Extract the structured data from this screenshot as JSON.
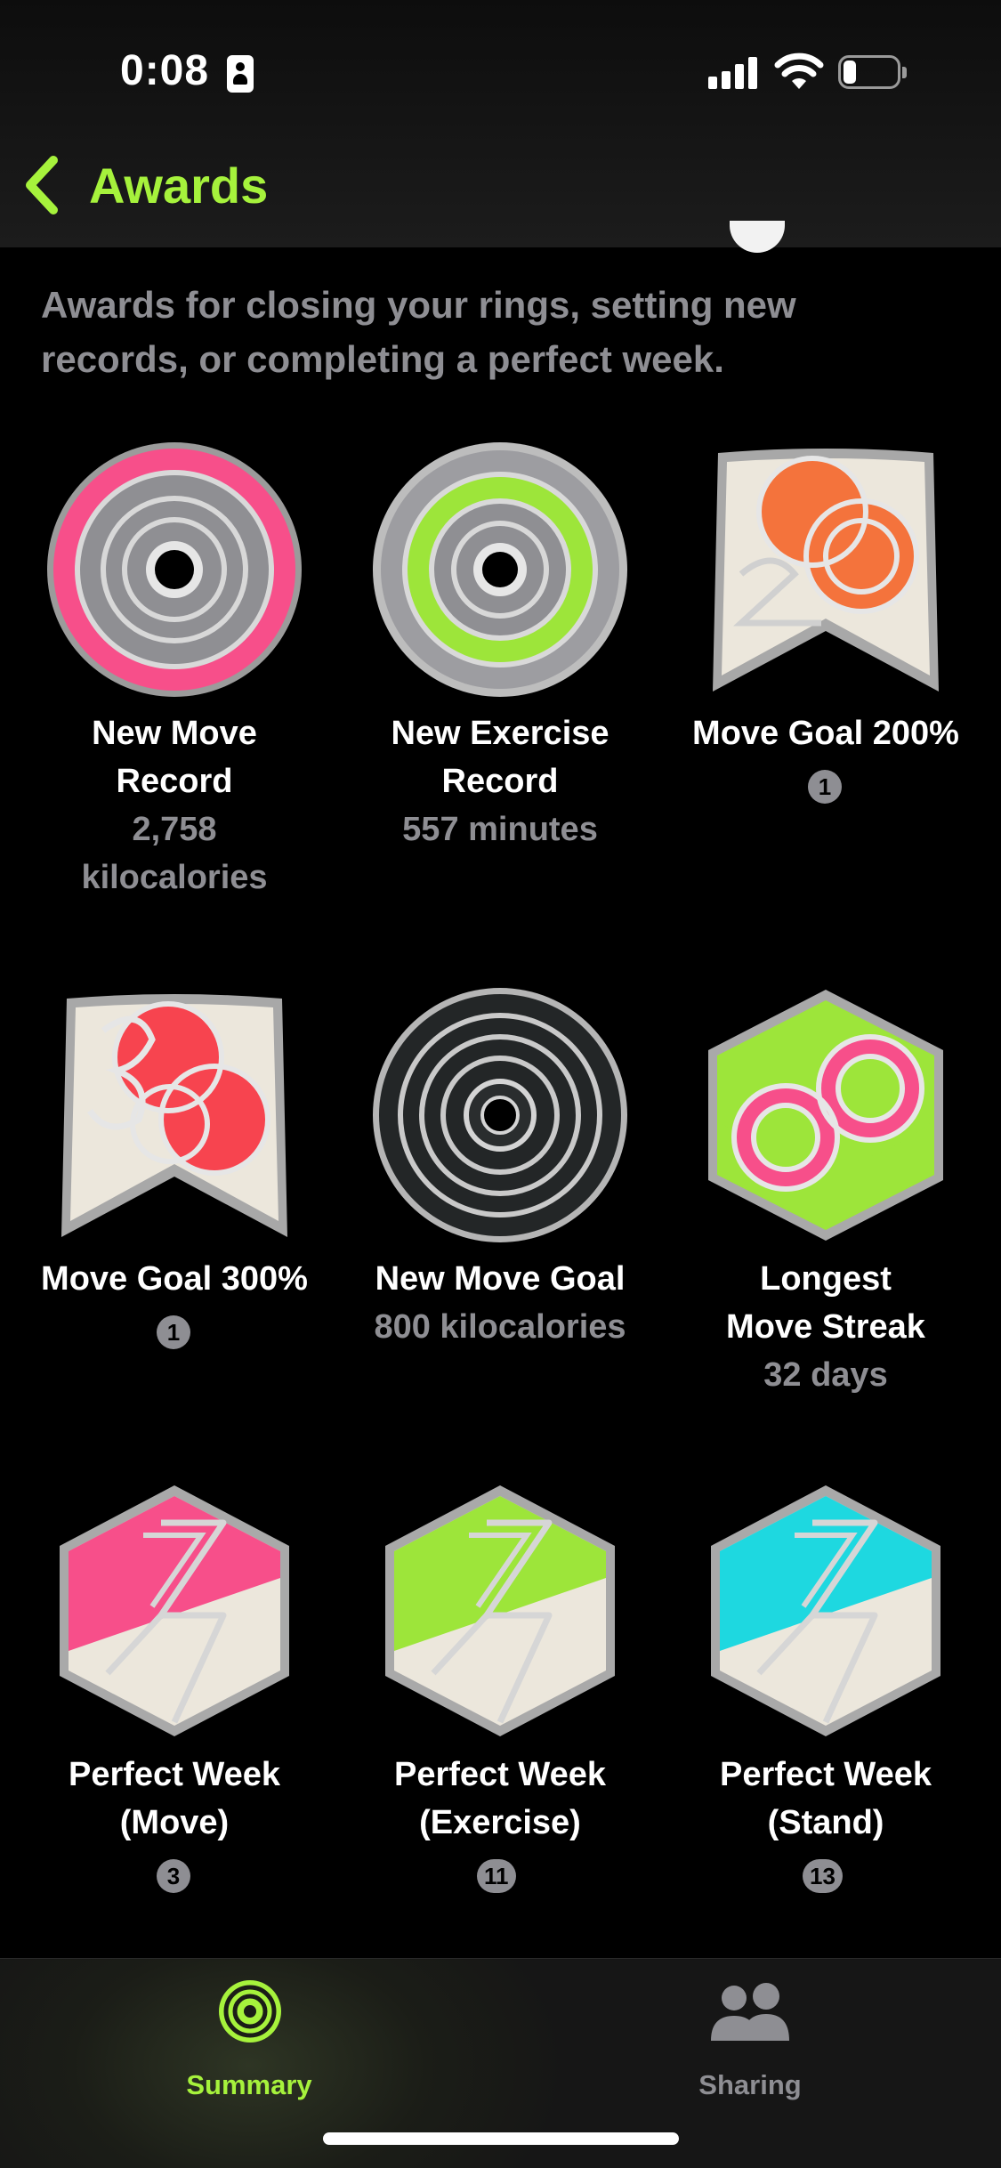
{
  "status_bar": {
    "time": "0:08"
  },
  "nav": {
    "back_title": "Awards"
  },
  "description": "Awards for closing your rings, setting new records, or completing a perfect week.",
  "awards": [
    {
      "line1": "New Move",
      "line2": "Record",
      "sub1": "2,758",
      "sub2": "kilocalories",
      "count": "",
      "badge": "move-record"
    },
    {
      "line1": "New Exercise",
      "line2": "Record",
      "sub1": "557 minutes",
      "sub2": "",
      "count": "",
      "badge": "exercise-record"
    },
    {
      "line1": "Move Goal 200%",
      "line2": "",
      "sub1": "",
      "sub2": "",
      "count": "1",
      "badge": "move-goal-200"
    },
    {
      "line1": "Move Goal 300%",
      "line2": "",
      "sub1": "",
      "sub2": "",
      "count": "1",
      "badge": "move-goal-300"
    },
    {
      "line1": "New Move Goal",
      "line2": "",
      "sub1": "800 kilocalories",
      "sub2": "",
      "count": "",
      "badge": "new-move-goal"
    },
    {
      "line1": "Longest",
      "line2": "Move Streak",
      "sub1": "32 days",
      "sub2": "",
      "count": "",
      "badge": "move-streak"
    },
    {
      "line1": "Perfect Week",
      "line2": "(Move)",
      "sub1": "",
      "sub2": "",
      "count": "3",
      "badge": "perfect-week-move"
    },
    {
      "line1": "Perfect Week",
      "line2": "(Exercise)",
      "sub1": "",
      "sub2": "",
      "count": "11",
      "badge": "perfect-week-exercise"
    },
    {
      "line1": "Perfect Week",
      "line2": "(Stand)",
      "sub1": "",
      "sub2": "",
      "count": "13",
      "badge": "perfect-week-stand"
    }
  ],
  "tabbar": {
    "summary": "Summary",
    "sharing": "Sharing"
  },
  "colors": {
    "accent": "#a6f23c",
    "move": "#f74f8a",
    "exercise": "#9de53a",
    "stand": "#1ed8e0",
    "orange": "#f4733c",
    "red": "#f7444f",
    "secondary_text": "#8e8e93"
  }
}
